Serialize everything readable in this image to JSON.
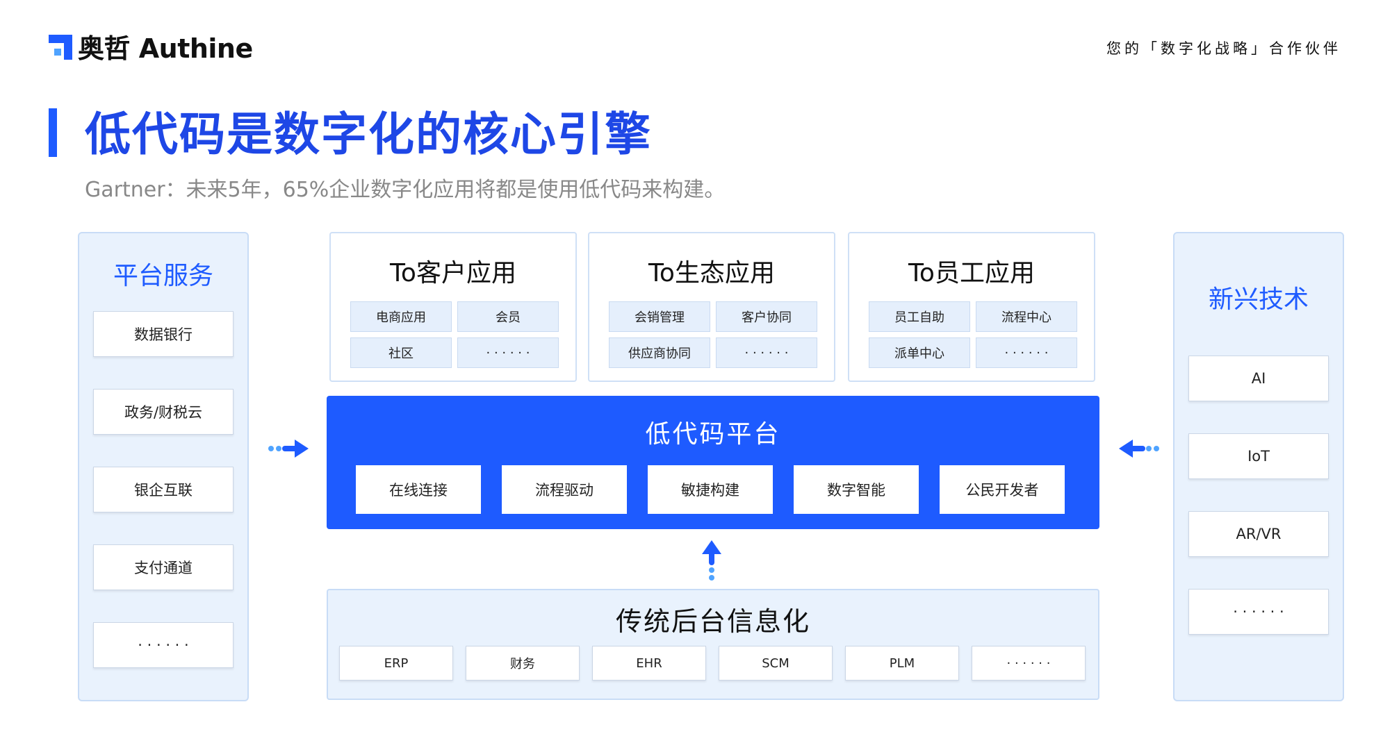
{
  "header": {
    "logo_text": "奥哲 Authine",
    "tagline": "您的「数字化战略」合作伙伴"
  },
  "title": "低代码是数字化的核心引擎",
  "subtitle": "Gartner：未来5年，65%企业数字化应用将都是使用低代码来构建。",
  "platform_services": {
    "title": "平台服务",
    "items": [
      "数据银行",
      "政务/财税云",
      "银企互联",
      "支付通道",
      "· · · · · ·"
    ]
  },
  "emerging_tech": {
    "title": "新兴技术",
    "items": [
      "AI",
      "IoT",
      "AR/VR",
      "· · · · · ·"
    ]
  },
  "app_groups": [
    {
      "title": "To客户应用",
      "items": [
        "电商应用",
        "会员",
        "社区",
        "· · · · · ·"
      ]
    },
    {
      "title": "To生态应用",
      "items": [
        "会销管理",
        "客户协同",
        "供应商协同",
        "· · · · · ·"
      ]
    },
    {
      "title": "To员工应用",
      "items": [
        "员工自助",
        "流程中心",
        "派单中心",
        "· · · · · ·"
      ]
    }
  ],
  "lowcode_platform": {
    "title": "低代码平台",
    "items": [
      "在线连接",
      "流程驱动",
      "敏捷构建",
      "数字智能",
      "公民开发者"
    ]
  },
  "legacy_backend": {
    "title": "传统后台信息化",
    "items": [
      "ERP",
      "财务",
      "EHR",
      "SCM",
      "PLM",
      "· · · · · ·"
    ]
  },
  "colors": {
    "primary": "#1e5bff",
    "title_blue": "#1e47e6",
    "panel_bg": "#e9f2fd",
    "chip_bg": "#e5effc",
    "arrow_light": "#4fa3ff"
  }
}
